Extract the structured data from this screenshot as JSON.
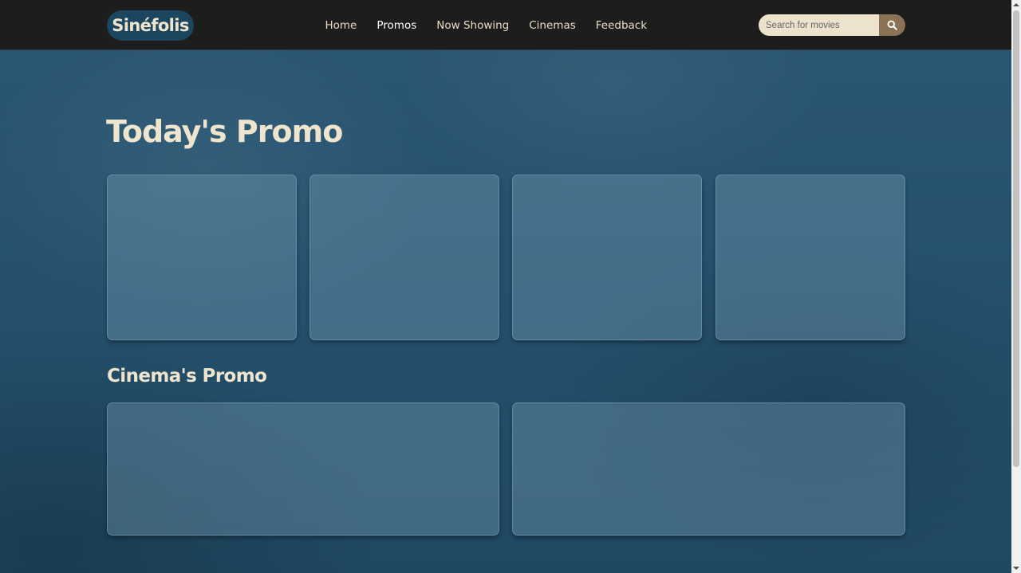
{
  "navbar": {
    "brand": "Sinéfolis",
    "links": [
      {
        "label": "Home",
        "active": false
      },
      {
        "label": "Promos",
        "active": true
      },
      {
        "label": "Now Showing",
        "active": false
      },
      {
        "label": "Cinemas",
        "active": false
      },
      {
        "label": "Feedback",
        "active": false
      }
    ],
    "search": {
      "placeholder": "Search for movies",
      "value": "",
      "button_icon": "search-icon"
    }
  },
  "main": {
    "todays_promo": {
      "title": "Today's Promo",
      "cards": 4
    },
    "cinemas_promo": {
      "title": "Cinema's Promo",
      "cards": 2
    }
  },
  "colors": {
    "navbar_bg": "#1d1d1d",
    "brand_pill": "#1c4660",
    "text_cream": "#efe5cf",
    "search_field": "#ede3cc",
    "search_button": "#8c7254",
    "page_bg": "#254f6b"
  }
}
